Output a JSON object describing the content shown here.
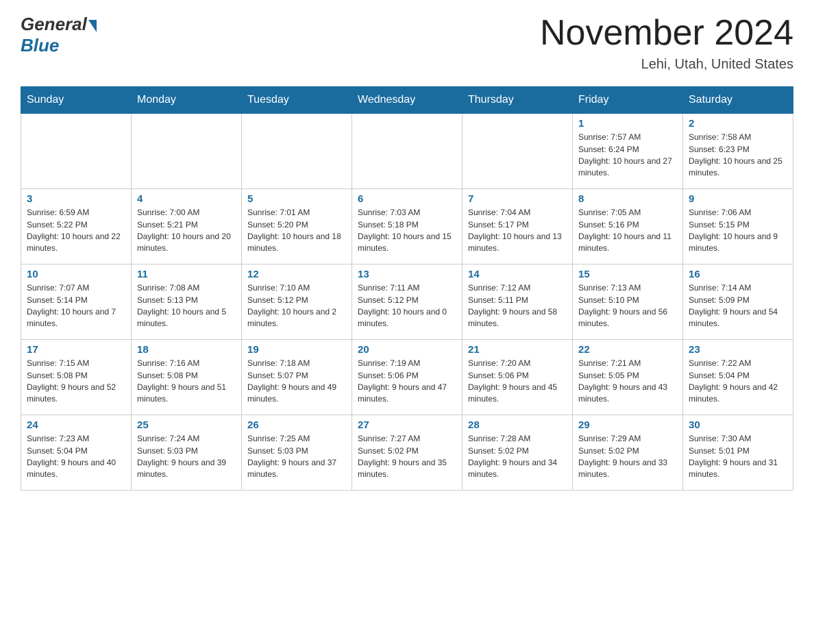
{
  "header": {
    "logo_general": "General",
    "logo_blue": "Blue",
    "month_title": "November 2024",
    "location": "Lehi, Utah, United States"
  },
  "weekdays": [
    "Sunday",
    "Monday",
    "Tuesday",
    "Wednesday",
    "Thursday",
    "Friday",
    "Saturday"
  ],
  "weeks": [
    [
      {
        "day": "",
        "info": ""
      },
      {
        "day": "",
        "info": ""
      },
      {
        "day": "",
        "info": ""
      },
      {
        "day": "",
        "info": ""
      },
      {
        "day": "",
        "info": ""
      },
      {
        "day": "1",
        "info": "Sunrise: 7:57 AM\nSunset: 6:24 PM\nDaylight: 10 hours and 27 minutes."
      },
      {
        "day": "2",
        "info": "Sunrise: 7:58 AM\nSunset: 6:23 PM\nDaylight: 10 hours and 25 minutes."
      }
    ],
    [
      {
        "day": "3",
        "info": "Sunrise: 6:59 AM\nSunset: 5:22 PM\nDaylight: 10 hours and 22 minutes."
      },
      {
        "day": "4",
        "info": "Sunrise: 7:00 AM\nSunset: 5:21 PM\nDaylight: 10 hours and 20 minutes."
      },
      {
        "day": "5",
        "info": "Sunrise: 7:01 AM\nSunset: 5:20 PM\nDaylight: 10 hours and 18 minutes."
      },
      {
        "day": "6",
        "info": "Sunrise: 7:03 AM\nSunset: 5:18 PM\nDaylight: 10 hours and 15 minutes."
      },
      {
        "day": "7",
        "info": "Sunrise: 7:04 AM\nSunset: 5:17 PM\nDaylight: 10 hours and 13 minutes."
      },
      {
        "day": "8",
        "info": "Sunrise: 7:05 AM\nSunset: 5:16 PM\nDaylight: 10 hours and 11 minutes."
      },
      {
        "day": "9",
        "info": "Sunrise: 7:06 AM\nSunset: 5:15 PM\nDaylight: 10 hours and 9 minutes."
      }
    ],
    [
      {
        "day": "10",
        "info": "Sunrise: 7:07 AM\nSunset: 5:14 PM\nDaylight: 10 hours and 7 minutes."
      },
      {
        "day": "11",
        "info": "Sunrise: 7:08 AM\nSunset: 5:13 PM\nDaylight: 10 hours and 5 minutes."
      },
      {
        "day": "12",
        "info": "Sunrise: 7:10 AM\nSunset: 5:12 PM\nDaylight: 10 hours and 2 minutes."
      },
      {
        "day": "13",
        "info": "Sunrise: 7:11 AM\nSunset: 5:12 PM\nDaylight: 10 hours and 0 minutes."
      },
      {
        "day": "14",
        "info": "Sunrise: 7:12 AM\nSunset: 5:11 PM\nDaylight: 9 hours and 58 minutes."
      },
      {
        "day": "15",
        "info": "Sunrise: 7:13 AM\nSunset: 5:10 PM\nDaylight: 9 hours and 56 minutes."
      },
      {
        "day": "16",
        "info": "Sunrise: 7:14 AM\nSunset: 5:09 PM\nDaylight: 9 hours and 54 minutes."
      }
    ],
    [
      {
        "day": "17",
        "info": "Sunrise: 7:15 AM\nSunset: 5:08 PM\nDaylight: 9 hours and 52 minutes."
      },
      {
        "day": "18",
        "info": "Sunrise: 7:16 AM\nSunset: 5:08 PM\nDaylight: 9 hours and 51 minutes."
      },
      {
        "day": "19",
        "info": "Sunrise: 7:18 AM\nSunset: 5:07 PM\nDaylight: 9 hours and 49 minutes."
      },
      {
        "day": "20",
        "info": "Sunrise: 7:19 AM\nSunset: 5:06 PM\nDaylight: 9 hours and 47 minutes."
      },
      {
        "day": "21",
        "info": "Sunrise: 7:20 AM\nSunset: 5:06 PM\nDaylight: 9 hours and 45 minutes."
      },
      {
        "day": "22",
        "info": "Sunrise: 7:21 AM\nSunset: 5:05 PM\nDaylight: 9 hours and 43 minutes."
      },
      {
        "day": "23",
        "info": "Sunrise: 7:22 AM\nSunset: 5:04 PM\nDaylight: 9 hours and 42 minutes."
      }
    ],
    [
      {
        "day": "24",
        "info": "Sunrise: 7:23 AM\nSunset: 5:04 PM\nDaylight: 9 hours and 40 minutes."
      },
      {
        "day": "25",
        "info": "Sunrise: 7:24 AM\nSunset: 5:03 PM\nDaylight: 9 hours and 39 minutes."
      },
      {
        "day": "26",
        "info": "Sunrise: 7:25 AM\nSunset: 5:03 PM\nDaylight: 9 hours and 37 minutes."
      },
      {
        "day": "27",
        "info": "Sunrise: 7:27 AM\nSunset: 5:02 PM\nDaylight: 9 hours and 35 minutes."
      },
      {
        "day": "28",
        "info": "Sunrise: 7:28 AM\nSunset: 5:02 PM\nDaylight: 9 hours and 34 minutes."
      },
      {
        "day": "29",
        "info": "Sunrise: 7:29 AM\nSunset: 5:02 PM\nDaylight: 9 hours and 33 minutes."
      },
      {
        "day": "30",
        "info": "Sunrise: 7:30 AM\nSunset: 5:01 PM\nDaylight: 9 hours and 31 minutes."
      }
    ]
  ]
}
